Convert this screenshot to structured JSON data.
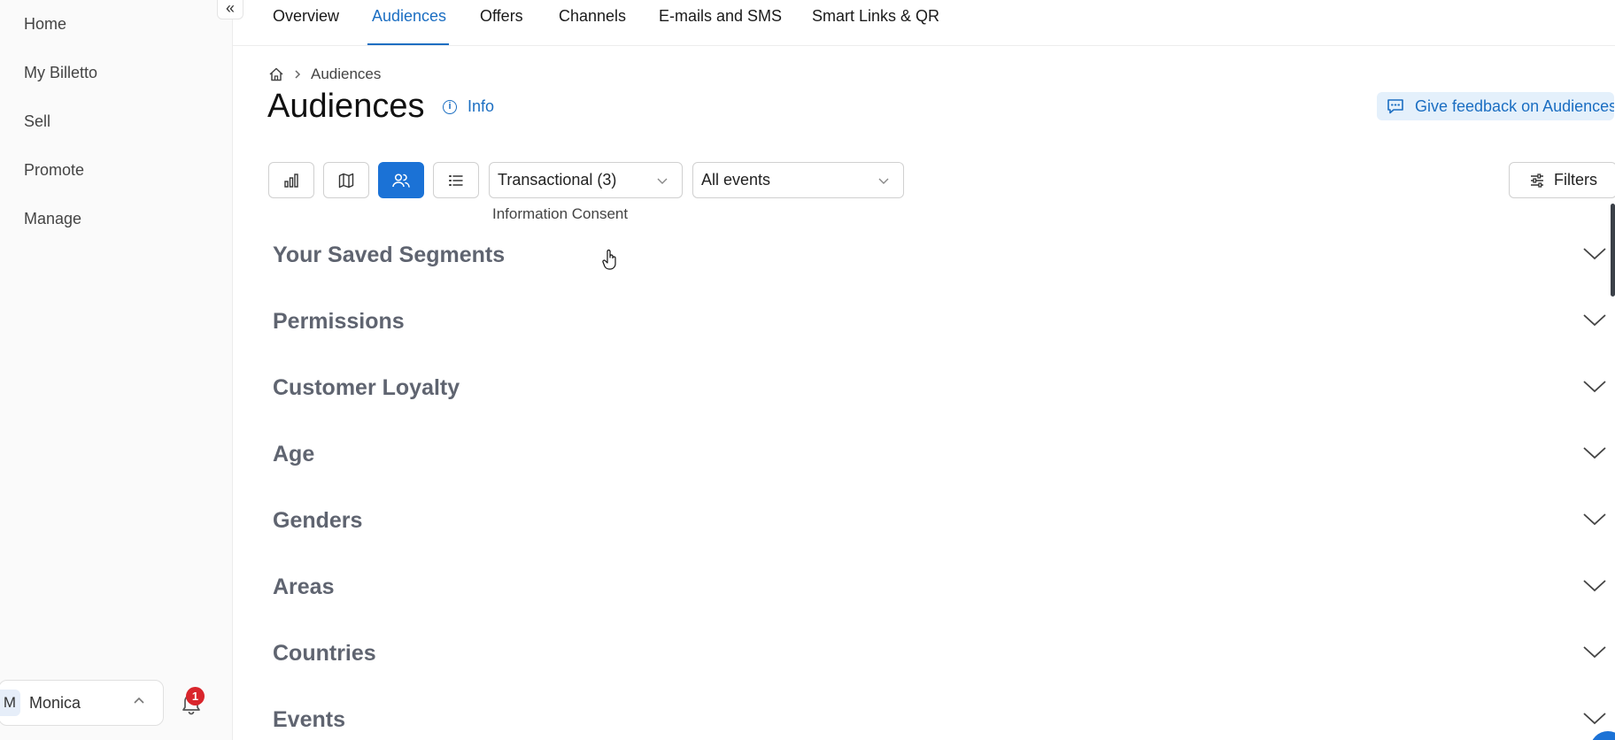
{
  "sidebar": {
    "collapse_icon": "double-chevron-left-icon",
    "collapse_glyph": "«",
    "items": [
      {
        "label": "Home"
      },
      {
        "label": "My Billetto"
      },
      {
        "label": "Sell"
      },
      {
        "label": "Promote"
      },
      {
        "label": "Manage"
      }
    ],
    "user": {
      "initial": "M",
      "name": "Monica"
    },
    "notifications": {
      "icon": "bell-icon",
      "count": "1"
    }
  },
  "tabs": [
    {
      "label": "Overview"
    },
    {
      "label": "Audiences",
      "active": true
    },
    {
      "label": "Offers"
    },
    {
      "label": "Channels"
    },
    {
      "label": "E-mails and SMS"
    },
    {
      "label": "Smart Links & QR"
    }
  ],
  "breadcrumb": {
    "home_icon": "home-icon",
    "current": "Audiences"
  },
  "header": {
    "title": "Audiences",
    "info_label": "Info",
    "feedback_label": "Give feedback on Audiences"
  },
  "toolbar": {
    "view_buttons": [
      {
        "icon": "bar-chart-icon"
      },
      {
        "icon": "map-icon"
      },
      {
        "icon": "users-icon",
        "active": true
      },
      {
        "icon": "list-icon"
      }
    ],
    "consent_select": {
      "value": "Transactional (3)",
      "caption": "Information Consent"
    },
    "events_select": {
      "value": "All events"
    },
    "filters_label": "Filters"
  },
  "sections": [
    {
      "title": "Your Saved Segments"
    },
    {
      "title": "Permissions"
    },
    {
      "title": "Customer Loyalty"
    },
    {
      "title": "Age"
    },
    {
      "title": "Genders"
    },
    {
      "title": "Areas"
    },
    {
      "title": "Countries"
    },
    {
      "title": "Events"
    }
  ],
  "colors": {
    "accent": "#1b6ec2",
    "active_button": "#1b72d6",
    "badge": "#d9252c",
    "section_title": "#5f6470"
  }
}
